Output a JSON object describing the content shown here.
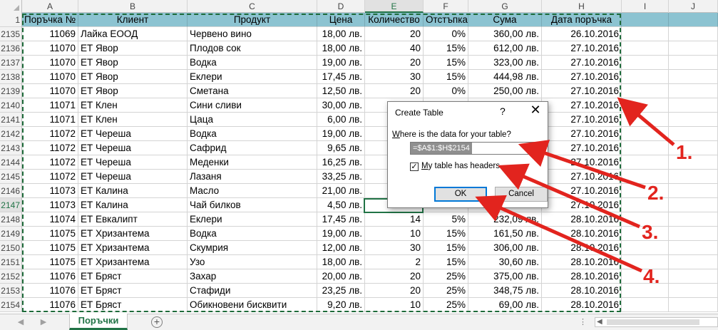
{
  "columns": {
    "letters": [
      "A",
      "B",
      "C",
      "D",
      "E",
      "F",
      "G",
      "H",
      "I",
      "J"
    ],
    "active_letter": "E"
  },
  "header_row": {
    "number": "1",
    "cells": [
      "Поръчка №",
      "Клиент",
      "Продукт",
      "Цена",
      "Количество",
      "Отстъпка",
      "Сума",
      "Дата поръчка"
    ]
  },
  "rows": [
    {
      "n": "2135",
      "a": "11069",
      "b": "Лайка ЕООД",
      "c": "Червено вино",
      "d": "18,00 лв.",
      "e": "20",
      "f": "0%",
      "g": "360,00 лв.",
      "h": "26.10.2016"
    },
    {
      "n": "2136",
      "a": "11070",
      "b": "ЕТ Явор",
      "c": "Плодов сок",
      "d": "18,00 лв.",
      "e": "40",
      "f": "15%",
      "g": "612,00 лв.",
      "h": "27.10.2016"
    },
    {
      "n": "2137",
      "a": "11070",
      "b": "ЕТ Явор",
      "c": "Водка",
      "d": "19,00 лв.",
      "e": "20",
      "f": "15%",
      "g": "323,00 лв.",
      "h": "27.10.2016"
    },
    {
      "n": "2138",
      "a": "11070",
      "b": "ЕТ Явор",
      "c": "Еклери",
      "d": "17,45 лв.",
      "e": "30",
      "f": "15%",
      "g": "444,98 лв.",
      "h": "27.10.2016"
    },
    {
      "n": "2139",
      "a": "11070",
      "b": "ЕТ Явор",
      "c": "Сметана",
      "d": "12,50 лв.",
      "e": "20",
      "f": "0%",
      "g": "250,00 лв.",
      "h": "27.10.2016"
    },
    {
      "n": "2140",
      "a": "11071",
      "b": "ЕТ Клен",
      "c": "Сини сливи",
      "d": "30,00 лв.",
      "e": "",
      "f": "",
      "g": "",
      "h": "27.10.2016"
    },
    {
      "n": "2141",
      "a": "11071",
      "b": "ЕТ Клен",
      "c": "Цаца",
      "d": "6,00 лв.",
      "e": "",
      "f": "",
      "g": "",
      "h": "27.10.2016"
    },
    {
      "n": "2142",
      "a": "11072",
      "b": "ЕТ Череша",
      "c": "Водка",
      "d": "19,00 лв.",
      "e": "",
      "f": "",
      "g": "",
      "h": "27.10.2016"
    },
    {
      "n": "2143",
      "a": "11072",
      "b": "ЕТ Череша",
      "c": "Сафрид",
      "d": "9,65 лв.",
      "e": "",
      "f": "",
      "g": "",
      "h": "27.10.2016"
    },
    {
      "n": "2144",
      "a": "11072",
      "b": "ЕТ Череша",
      "c": "Меденки",
      "d": "16,25 лв.",
      "e": "",
      "f": "",
      "g": "",
      "h": "27.10.2016"
    },
    {
      "n": "2145",
      "a": "11072",
      "b": "ЕТ Череша",
      "c": "Лазаня",
      "d": "33,25 лв.",
      "e": "",
      "f": "",
      "g": "",
      "h": "27.10.2016"
    },
    {
      "n": "2146",
      "a": "11073",
      "b": "ЕТ Калина",
      "c": "Масло",
      "d": "21,00 лв.",
      "e": "",
      "f": "",
      "g": "",
      "h": "27.10.2016"
    },
    {
      "n": "2147",
      "a": "11073",
      "b": "ЕТ Калина",
      "c": "Чай билков",
      "d": "4,50 лв.",
      "e": "",
      "f": "",
      "g": "",
      "h": "27.10.2016"
    },
    {
      "n": "2148",
      "a": "11074",
      "b": "ЕТ Евкалипт",
      "c": "Еклери",
      "d": "17,45 лв.",
      "e": "14",
      "f": "5%",
      "g": "232,09 лв.",
      "h": "28.10.2016"
    },
    {
      "n": "2149",
      "a": "11075",
      "b": "ЕТ Хризантема",
      "c": "Водка",
      "d": "19,00 лв.",
      "e": "10",
      "f": "15%",
      "g": "161,50 лв.",
      "h": "28.10.2016"
    },
    {
      "n": "2150",
      "a": "11075",
      "b": "ЕТ Хризантема",
      "c": "Скумрия",
      "d": "12,00 лв.",
      "e": "30",
      "f": "15%",
      "g": "306,00 лв.",
      "h": "28.10.2016"
    },
    {
      "n": "2151",
      "a": "11075",
      "b": "ЕТ Хризантема",
      "c": "Узо",
      "d": "18,00 лв.",
      "e": "2",
      "f": "15%",
      "g": "30,60 лв.",
      "h": "28.10.2016"
    },
    {
      "n": "2152",
      "a": "11076",
      "b": "ЕТ Бряст",
      "c": "Захар",
      "d": "20,00 лв.",
      "e": "20",
      "f": "25%",
      "g": "375,00 лв.",
      "h": "28.10.2016"
    },
    {
      "n": "2153",
      "a": "11076",
      "b": "ЕТ Бряст",
      "c": "Стафиди",
      "d": "23,25 лв.",
      "e": "20",
      "f": "25%",
      "g": "348,75 лв.",
      "h": "28.10.2016"
    },
    {
      "n": "2154",
      "a": "11076",
      "b": "ЕТ Бряст",
      "c": "Обикновени бисквити",
      "d": "9,20 лв.",
      "e": "10",
      "f": "25%",
      "g": "69,00 лв.",
      "h": "28.10.2016"
    }
  ],
  "active_row_number": "2147",
  "dialog": {
    "title": "Create Table",
    "help": "?",
    "close": "✕",
    "prompt_underlined": "W",
    "prompt_rest": "here is the data for your table?",
    "range_value": "=$A$1:$H$2154",
    "checkbox_checked": "✓",
    "checkbox_label_underlined": "M",
    "checkbox_label_rest": "y table has headers",
    "ok_label": "OK",
    "cancel_label": "Cancel"
  },
  "tabbar": {
    "sheet_name": "Поръчки",
    "add_sheet": "+",
    "dots": "⋮",
    "nav_left": "◀",
    "nav_right": "▶",
    "scroll_left": "◀"
  },
  "annotations": {
    "color": "#e2241e",
    "labels": [
      "1.",
      "2.",
      "3.",
      "4."
    ]
  },
  "colors": {
    "header_fill": "#8cc3d1",
    "excel_green": "#217346"
  }
}
